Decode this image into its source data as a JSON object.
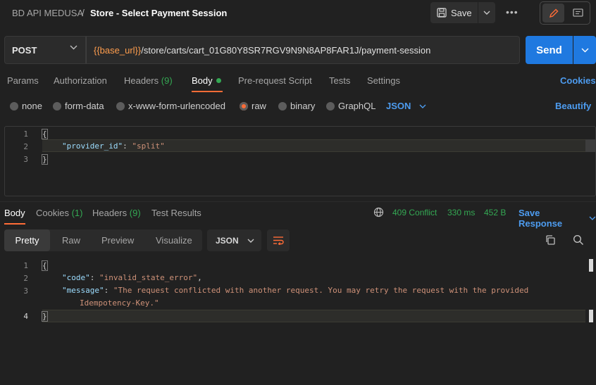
{
  "header": {
    "workspace": "BD API MEDUSA",
    "separator": "/",
    "title": "Store - Select Payment Session",
    "save_label": "Save",
    "more_label": "•••"
  },
  "request": {
    "method": "POST",
    "url_variable": "{{base_url}}",
    "url_path": "/store/carts/cart_01G80Y8SR7RGV9N9N8AP8FAR1J/payment-session",
    "send_label": "Send"
  },
  "request_tabs": {
    "params": "Params",
    "authorization": "Authorization",
    "headers": "Headers",
    "headers_count": "(9)",
    "body": "Body",
    "prerequest": "Pre-request Script",
    "tests": "Tests",
    "settings": "Settings",
    "cookies": "Cookies"
  },
  "body_types": {
    "none": "none",
    "form_data": "form-data",
    "urlencoded": "x-www-form-urlencoded",
    "raw": "raw",
    "binary": "binary",
    "graphql": "GraphQL",
    "language": "JSON",
    "beautify": "Beautify"
  },
  "request_body": {
    "lines": [
      "1",
      "2",
      "3"
    ],
    "open_brace": "{",
    "key": "\"provider_id\"",
    "colon": ": ",
    "value": "\"split\"",
    "close_brace": "}"
  },
  "response_tabs": {
    "body": "Body",
    "cookies": "Cookies",
    "cookies_count": "(1)",
    "headers": "Headers",
    "headers_count": "(9)",
    "test_results": "Test Results",
    "status": "409 Conflict",
    "time": "330 ms",
    "size": "452 B",
    "save_response": "Save Response"
  },
  "response_format": {
    "pretty": "Pretty",
    "raw": "Raw",
    "preview": "Preview",
    "visualize": "Visualize",
    "language": "JSON"
  },
  "response_body": {
    "lines": [
      "1",
      "2",
      "3",
      "4"
    ],
    "open_brace": "{",
    "code_key": "\"code\"",
    "code_value": "\"invalid_state_error\"",
    "message_key": "\"message\"",
    "message_value_1": "\"The request conflicted with another request. You may retry the request with the provided",
    "message_value_2": "Idempotency-Key.\"",
    "close_brace": "}"
  },
  "colors": {
    "accent": "#ff6c37",
    "link": "#4d9cf0",
    "success": "#34a853",
    "send": "#1f79e0"
  }
}
